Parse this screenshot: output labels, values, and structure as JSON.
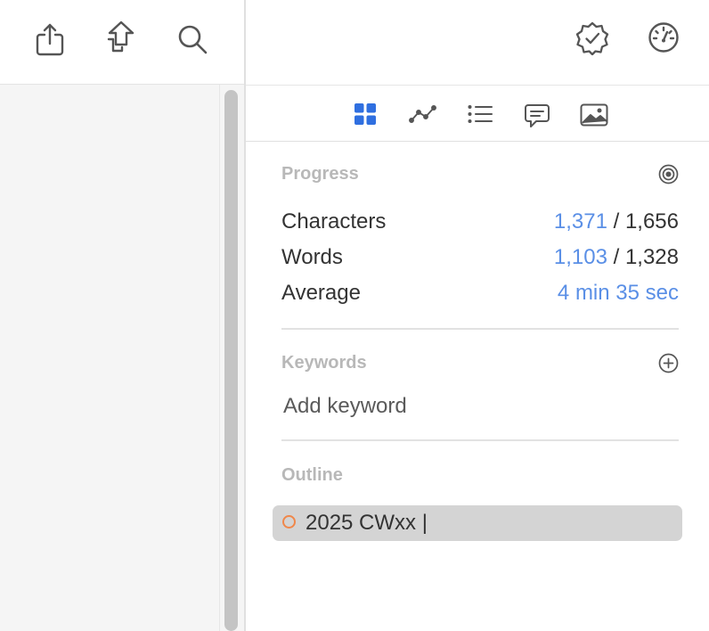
{
  "toolbar": {
    "left_icons": [
      "share-icon",
      "move-icon",
      "search-icon"
    ],
    "right_icons": [
      "verified-badge-icon",
      "gauge-icon"
    ]
  },
  "tabs": [
    {
      "icon": "grid-icon",
      "active": true
    },
    {
      "icon": "line-chart-icon",
      "active": false
    },
    {
      "icon": "list-icon",
      "active": false
    },
    {
      "icon": "comment-icon",
      "active": false
    },
    {
      "icon": "image-icon",
      "active": false
    }
  ],
  "progress": {
    "title": "Progress",
    "characters": {
      "label": "Characters",
      "current": "1,371",
      "separator": " / ",
      "total": "1,656"
    },
    "words": {
      "label": "Words",
      "current": "1,103",
      "separator": " / ",
      "total": "1,328"
    },
    "average": {
      "label": "Average",
      "value": "4 min 35 sec"
    }
  },
  "keywords": {
    "title": "Keywords",
    "placeholder": "Add keyword"
  },
  "outline": {
    "title": "Outline",
    "items": [
      {
        "text": "2025 CWxx |"
      }
    ]
  },
  "colors": {
    "accent_blue": "#5a8fe6",
    "outline_dot": "#f0874a",
    "section_title": "#b8b8b8"
  }
}
